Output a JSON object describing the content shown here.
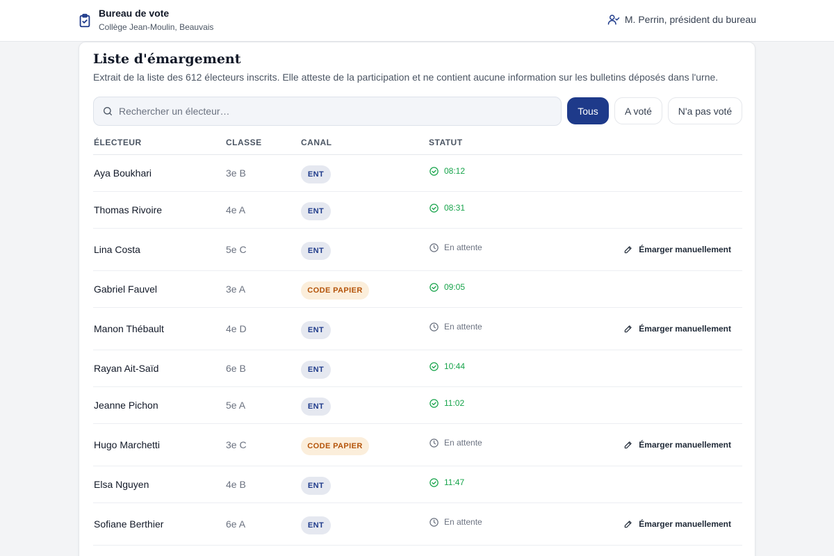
{
  "header": {
    "title": "Bureau de vote",
    "subtitle": "Collège Jean-Moulin, Beauvais",
    "user": "M. Perrin, président du bureau"
  },
  "card": {
    "title": "Liste d'émargement",
    "description": "Extrait de la liste des 612 électeurs inscrits. Elle atteste de la participation et ne contient aucune information sur les bulletins déposés dans l'urne."
  },
  "search": {
    "placeholder": "Rechercher un électeur…"
  },
  "filters": [
    {
      "label": "Tous",
      "active": true
    },
    {
      "label": "A voté",
      "active": false
    },
    {
      "label": "N'a pas voté",
      "active": false
    }
  ],
  "table": {
    "columns": [
      "ÉLECTEUR",
      "CLASSE",
      "CANAL",
      "STATUT"
    ],
    "rows": [
      {
        "name": "Aya Boukhari",
        "class": "3e B",
        "channel": "ENT",
        "status": "08:12",
        "voted": true
      },
      {
        "name": "Thomas Rivoire",
        "class": "4e A",
        "channel": "ENT",
        "status": "08:31",
        "voted": true
      },
      {
        "name": "Lina Costa",
        "class": "5e C",
        "channel": "ENT",
        "status": "En attente",
        "voted": false,
        "action": "Émarger manuellement"
      },
      {
        "name": "Gabriel Fauvel",
        "class": "3e A",
        "channel": "CODE PAPIER",
        "status": "09:05",
        "voted": true
      },
      {
        "name": "Manon Thébault",
        "class": "4e D",
        "channel": "ENT",
        "status": "En attente",
        "voted": false,
        "action": "Émarger manuellement"
      },
      {
        "name": "Rayan Ait-Saïd",
        "class": "6e B",
        "channel": "ENT",
        "status": "10:44",
        "voted": true
      },
      {
        "name": "Jeanne Pichon",
        "class": "5e A",
        "channel": "ENT",
        "status": "11:02",
        "voted": true
      },
      {
        "name": "Hugo Marchetti",
        "class": "3e C",
        "channel": "CODE PAPIER",
        "status": "En attente",
        "voted": false,
        "action": "Émarger manuellement"
      },
      {
        "name": "Elsa Nguyen",
        "class": "4e B",
        "channel": "ENT",
        "status": "11:47",
        "voted": true
      },
      {
        "name": "Sofiane Berthier",
        "class": "6e A",
        "channel": "ENT",
        "status": "En attente",
        "voted": false,
        "action": "Émarger manuellement"
      }
    ]
  },
  "colors": {
    "primary": "#1e3a8a",
    "voted": "#16a34a",
    "pending": "#6b7280",
    "paper_badge_text": "#b45309"
  }
}
